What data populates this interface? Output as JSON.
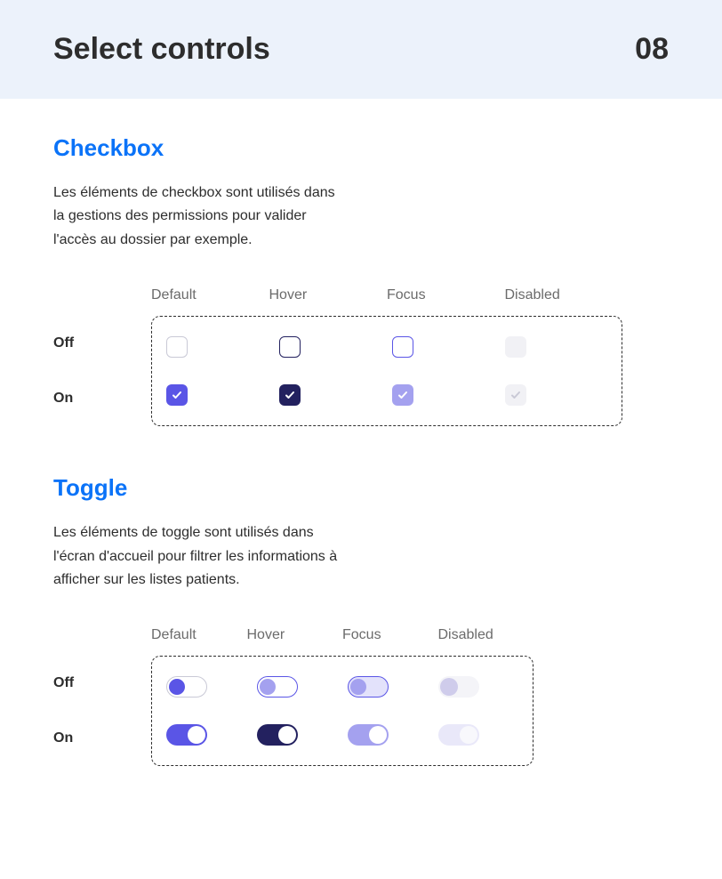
{
  "header": {
    "title": "Select controls",
    "page_number": "08"
  },
  "states": {
    "columns": [
      "Default",
      "Hover",
      "Focus",
      "Disabled"
    ],
    "rows": [
      "Off",
      "On"
    ]
  },
  "checkbox": {
    "title": "Checkbox",
    "description": "Les éléments de checkbox sont utilisés dans la gestions des permissions pour valider l'accès au dossier par exemple."
  },
  "toggle": {
    "title": "Toggle",
    "description": "Les éléments de toggle sont utilisés dans l'écran d'accueil pour filtrer les informations à afficher sur les listes patients."
  }
}
